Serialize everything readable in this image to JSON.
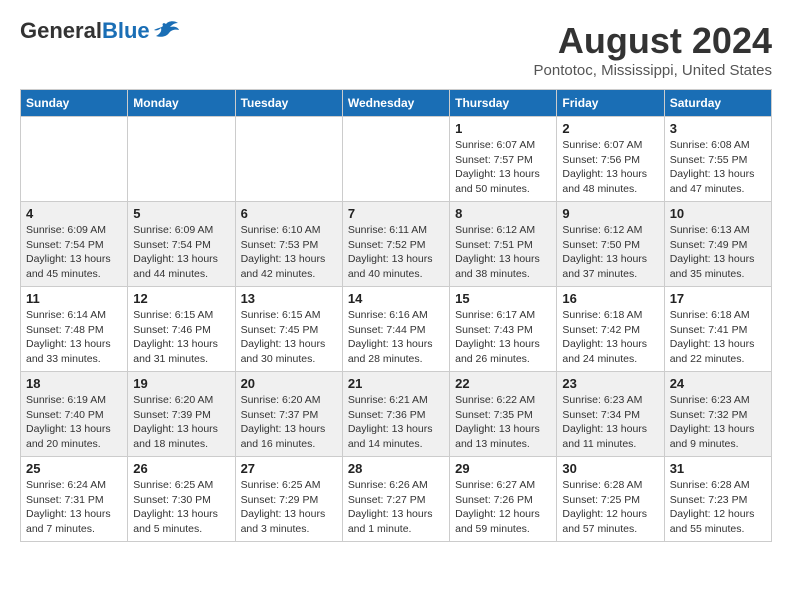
{
  "header": {
    "logo_general": "General",
    "logo_blue": "Blue",
    "month_title": "August 2024",
    "location": "Pontotoc, Mississippi, United States"
  },
  "days_of_week": [
    "Sunday",
    "Monday",
    "Tuesday",
    "Wednesday",
    "Thursday",
    "Friday",
    "Saturday"
  ],
  "weeks": [
    [
      {
        "day": "",
        "info": ""
      },
      {
        "day": "",
        "info": ""
      },
      {
        "day": "",
        "info": ""
      },
      {
        "day": "",
        "info": ""
      },
      {
        "day": "1",
        "info": "Sunrise: 6:07 AM\nSunset: 7:57 PM\nDaylight: 13 hours\nand 50 minutes."
      },
      {
        "day": "2",
        "info": "Sunrise: 6:07 AM\nSunset: 7:56 PM\nDaylight: 13 hours\nand 48 minutes."
      },
      {
        "day": "3",
        "info": "Sunrise: 6:08 AM\nSunset: 7:55 PM\nDaylight: 13 hours\nand 47 minutes."
      }
    ],
    [
      {
        "day": "4",
        "info": "Sunrise: 6:09 AM\nSunset: 7:54 PM\nDaylight: 13 hours\nand 45 minutes."
      },
      {
        "day": "5",
        "info": "Sunrise: 6:09 AM\nSunset: 7:54 PM\nDaylight: 13 hours\nand 44 minutes."
      },
      {
        "day": "6",
        "info": "Sunrise: 6:10 AM\nSunset: 7:53 PM\nDaylight: 13 hours\nand 42 minutes."
      },
      {
        "day": "7",
        "info": "Sunrise: 6:11 AM\nSunset: 7:52 PM\nDaylight: 13 hours\nand 40 minutes."
      },
      {
        "day": "8",
        "info": "Sunrise: 6:12 AM\nSunset: 7:51 PM\nDaylight: 13 hours\nand 38 minutes."
      },
      {
        "day": "9",
        "info": "Sunrise: 6:12 AM\nSunset: 7:50 PM\nDaylight: 13 hours\nand 37 minutes."
      },
      {
        "day": "10",
        "info": "Sunrise: 6:13 AM\nSunset: 7:49 PM\nDaylight: 13 hours\nand 35 minutes."
      }
    ],
    [
      {
        "day": "11",
        "info": "Sunrise: 6:14 AM\nSunset: 7:48 PM\nDaylight: 13 hours\nand 33 minutes."
      },
      {
        "day": "12",
        "info": "Sunrise: 6:15 AM\nSunset: 7:46 PM\nDaylight: 13 hours\nand 31 minutes."
      },
      {
        "day": "13",
        "info": "Sunrise: 6:15 AM\nSunset: 7:45 PM\nDaylight: 13 hours\nand 30 minutes."
      },
      {
        "day": "14",
        "info": "Sunrise: 6:16 AM\nSunset: 7:44 PM\nDaylight: 13 hours\nand 28 minutes."
      },
      {
        "day": "15",
        "info": "Sunrise: 6:17 AM\nSunset: 7:43 PM\nDaylight: 13 hours\nand 26 minutes."
      },
      {
        "day": "16",
        "info": "Sunrise: 6:18 AM\nSunset: 7:42 PM\nDaylight: 13 hours\nand 24 minutes."
      },
      {
        "day": "17",
        "info": "Sunrise: 6:18 AM\nSunset: 7:41 PM\nDaylight: 13 hours\nand 22 minutes."
      }
    ],
    [
      {
        "day": "18",
        "info": "Sunrise: 6:19 AM\nSunset: 7:40 PM\nDaylight: 13 hours\nand 20 minutes."
      },
      {
        "day": "19",
        "info": "Sunrise: 6:20 AM\nSunset: 7:39 PM\nDaylight: 13 hours\nand 18 minutes."
      },
      {
        "day": "20",
        "info": "Sunrise: 6:20 AM\nSunset: 7:37 PM\nDaylight: 13 hours\nand 16 minutes."
      },
      {
        "day": "21",
        "info": "Sunrise: 6:21 AM\nSunset: 7:36 PM\nDaylight: 13 hours\nand 14 minutes."
      },
      {
        "day": "22",
        "info": "Sunrise: 6:22 AM\nSunset: 7:35 PM\nDaylight: 13 hours\nand 13 minutes."
      },
      {
        "day": "23",
        "info": "Sunrise: 6:23 AM\nSunset: 7:34 PM\nDaylight: 13 hours\nand 11 minutes."
      },
      {
        "day": "24",
        "info": "Sunrise: 6:23 AM\nSunset: 7:32 PM\nDaylight: 13 hours\nand 9 minutes."
      }
    ],
    [
      {
        "day": "25",
        "info": "Sunrise: 6:24 AM\nSunset: 7:31 PM\nDaylight: 13 hours\nand 7 minutes."
      },
      {
        "day": "26",
        "info": "Sunrise: 6:25 AM\nSunset: 7:30 PM\nDaylight: 13 hours\nand 5 minutes."
      },
      {
        "day": "27",
        "info": "Sunrise: 6:25 AM\nSunset: 7:29 PM\nDaylight: 13 hours\nand 3 minutes."
      },
      {
        "day": "28",
        "info": "Sunrise: 6:26 AM\nSunset: 7:27 PM\nDaylight: 13 hours\nand 1 minute."
      },
      {
        "day": "29",
        "info": "Sunrise: 6:27 AM\nSunset: 7:26 PM\nDaylight: 12 hours\nand 59 minutes."
      },
      {
        "day": "30",
        "info": "Sunrise: 6:28 AM\nSunset: 7:25 PM\nDaylight: 12 hours\nand 57 minutes."
      },
      {
        "day": "31",
        "info": "Sunrise: 6:28 AM\nSunset: 7:23 PM\nDaylight: 12 hours\nand 55 minutes."
      }
    ]
  ]
}
